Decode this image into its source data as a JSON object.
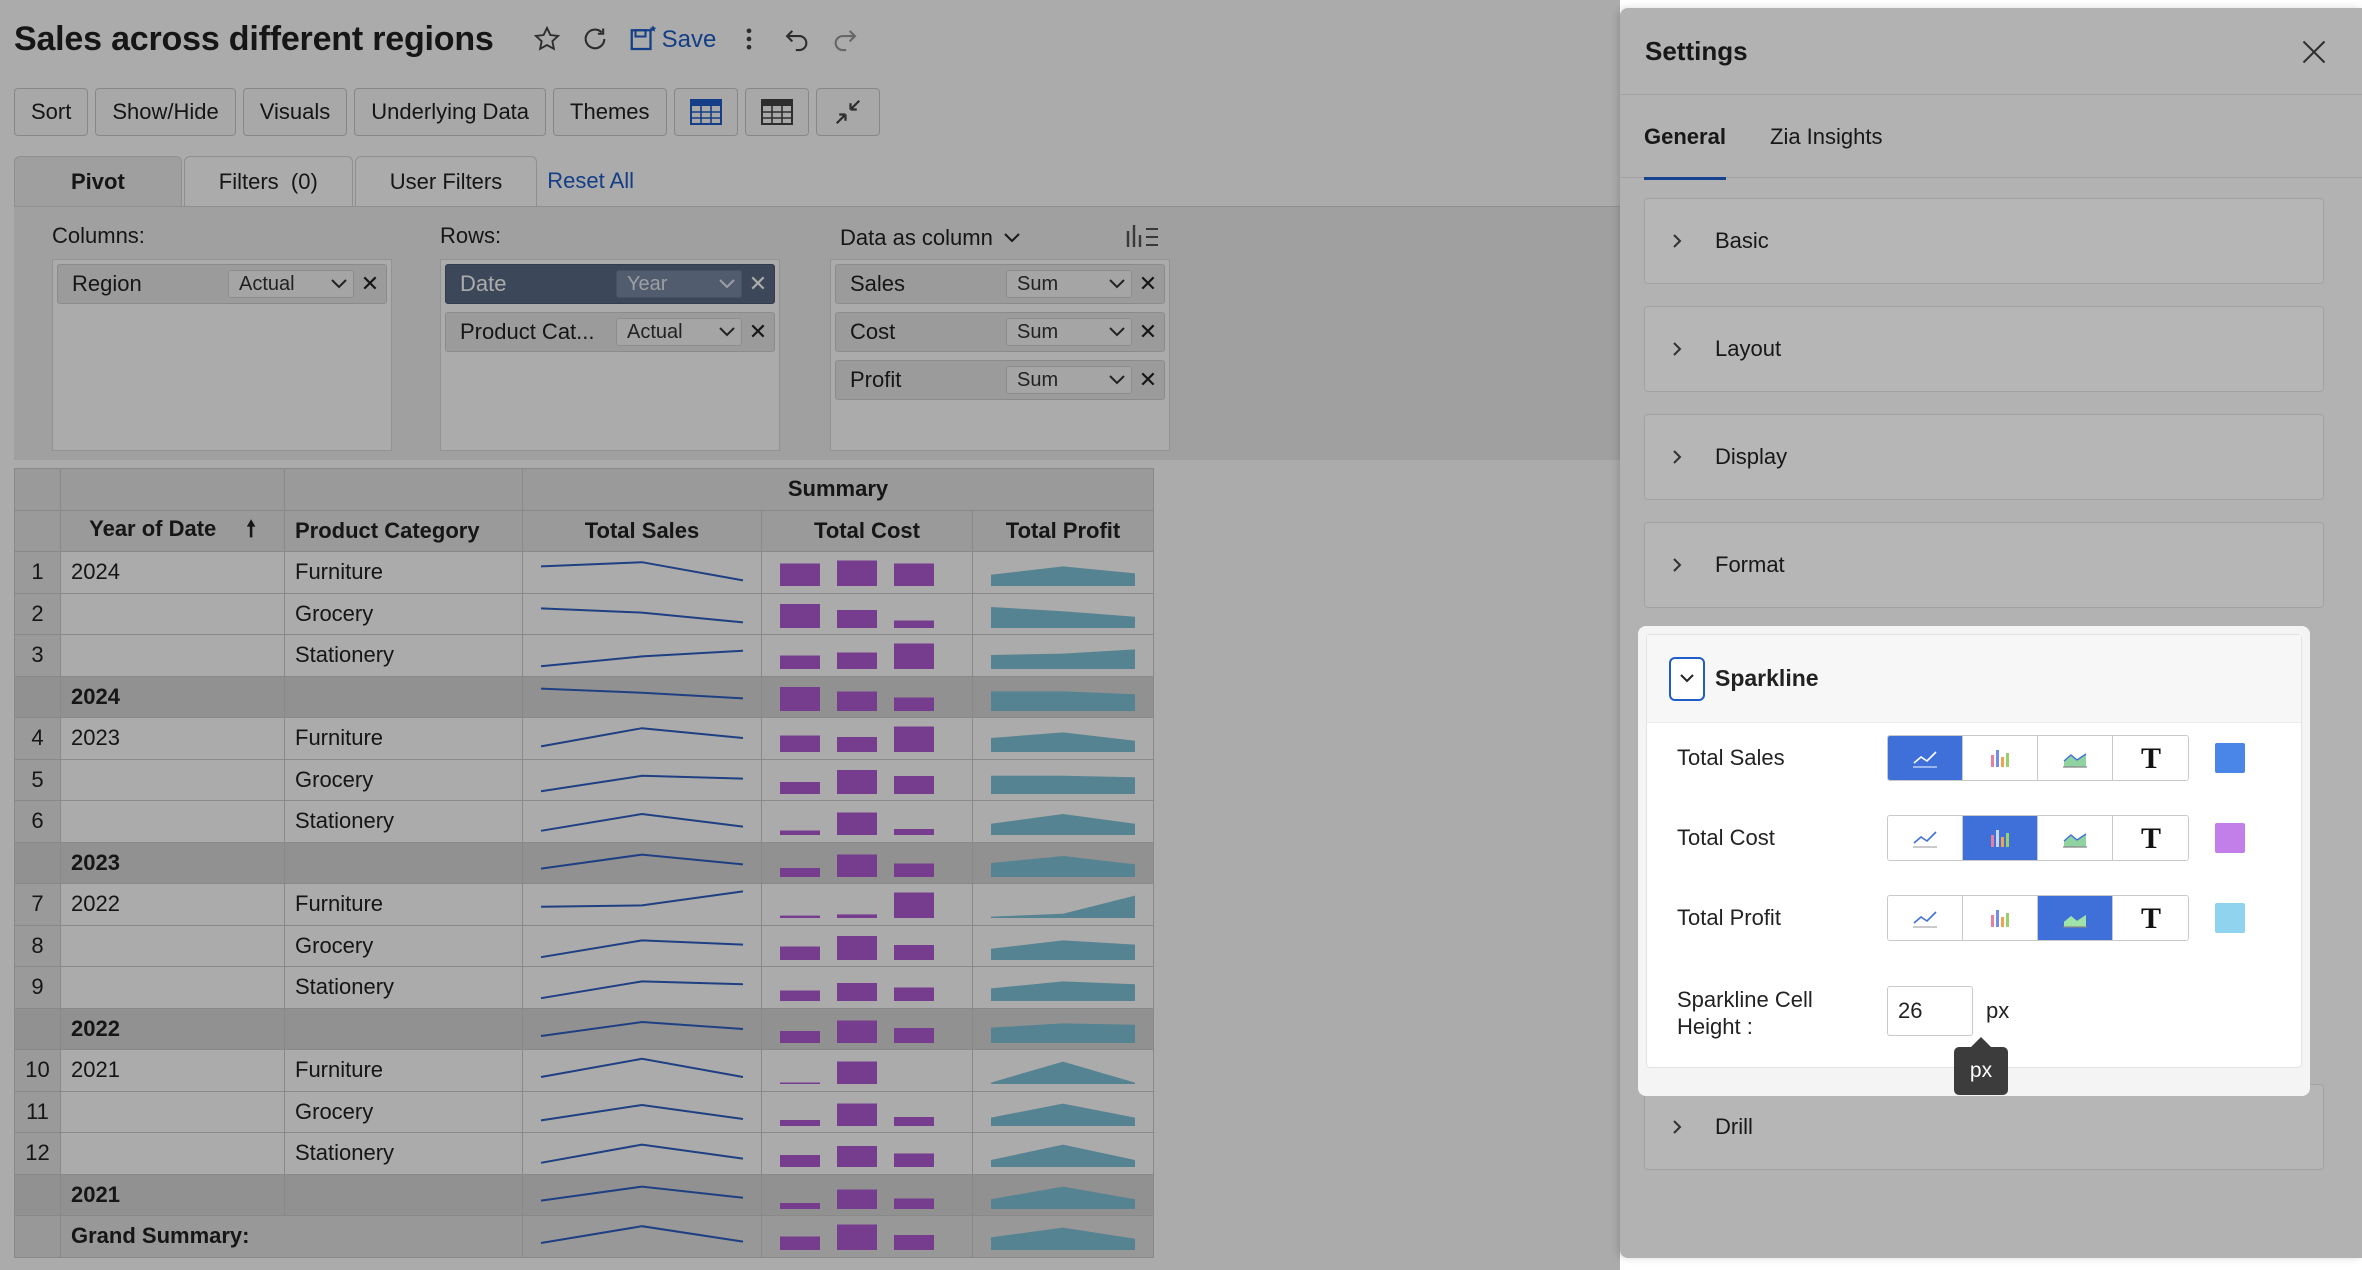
{
  "report": {
    "title": "Sales across different regions",
    "save_label": "Save"
  },
  "toolbar": {
    "sort": "Sort",
    "show_hide": "Show/Hide",
    "visuals": "Visuals",
    "underlying_data": "Underlying Data",
    "themes": "Themes"
  },
  "pivot_tabs": {
    "pivot": "Pivot",
    "filters": "Filters  (0)",
    "user_filters": "User Filters",
    "reset_all": "Reset All"
  },
  "pivot": {
    "columns_label": "Columns:",
    "rows_label": "Rows:",
    "data_label": "Data as column",
    "columns": [
      {
        "name": "Region",
        "func": "Actual"
      }
    ],
    "rows": [
      {
        "name": "Date",
        "func": "Year"
      },
      {
        "name": "Product Cat...",
        "func": "Actual"
      }
    ],
    "data": [
      {
        "name": "Sales",
        "func": "Sum"
      },
      {
        "name": "Cost",
        "func": "Sum"
      },
      {
        "name": "Profit",
        "func": "Sum"
      }
    ]
  },
  "table": {
    "summary_header": "Summary",
    "headers": [
      "Year of Date",
      "Product Category",
      "Total Sales",
      "Total Cost",
      "Total Profit"
    ],
    "grand_label": "Grand Summary:",
    "rows": [
      {
        "num": "1",
        "year": "2024",
        "cat": "Furniture"
      },
      {
        "num": "2",
        "year": "",
        "cat": "Grocery"
      },
      {
        "num": "3",
        "year": "",
        "cat": "Stationery"
      },
      {
        "num": "",
        "year": "2024",
        "cat": "",
        "subtotal": true
      },
      {
        "num": "4",
        "year": "2023",
        "cat": "Furniture"
      },
      {
        "num": "5",
        "year": "",
        "cat": "Grocery"
      },
      {
        "num": "6",
        "year": "",
        "cat": "Stationery"
      },
      {
        "num": "",
        "year": "2023",
        "cat": "",
        "subtotal": true
      },
      {
        "num": "7",
        "year": "2022",
        "cat": "Furniture"
      },
      {
        "num": "8",
        "year": "",
        "cat": "Grocery"
      },
      {
        "num": "9",
        "year": "",
        "cat": "Stationery"
      },
      {
        "num": "",
        "year": "2022",
        "cat": "",
        "subtotal": true
      },
      {
        "num": "10",
        "year": "2021",
        "cat": "Furniture"
      },
      {
        "num": "11",
        "year": "",
        "cat": "Grocery"
      },
      {
        "num": "12",
        "year": "",
        "cat": "Stationery"
      },
      {
        "num": "",
        "year": "2021",
        "cat": "",
        "subtotal": true
      }
    ]
  },
  "settings": {
    "title": "Settings",
    "tabs": [
      "General",
      "Zia Insights"
    ],
    "sections": [
      "Basic",
      "Layout",
      "Display",
      "Format",
      "Drill"
    ],
    "sparkline": {
      "title": "Sparkline",
      "rows": [
        {
          "label": "Total Sales",
          "selected": "line",
          "color": "#4a86e8"
        },
        {
          "label": "Total Cost",
          "selected": "bar",
          "color": "#c27ee9"
        },
        {
          "label": "Total Profit",
          "selected": "area",
          "color": "#8fd3ef"
        }
      ],
      "cell_height_label_1": "Sparkline Cell",
      "cell_height_label_2": "Height :",
      "cell_height_value": "26",
      "cell_height_unit": "px",
      "tooltip": "px"
    }
  }
}
